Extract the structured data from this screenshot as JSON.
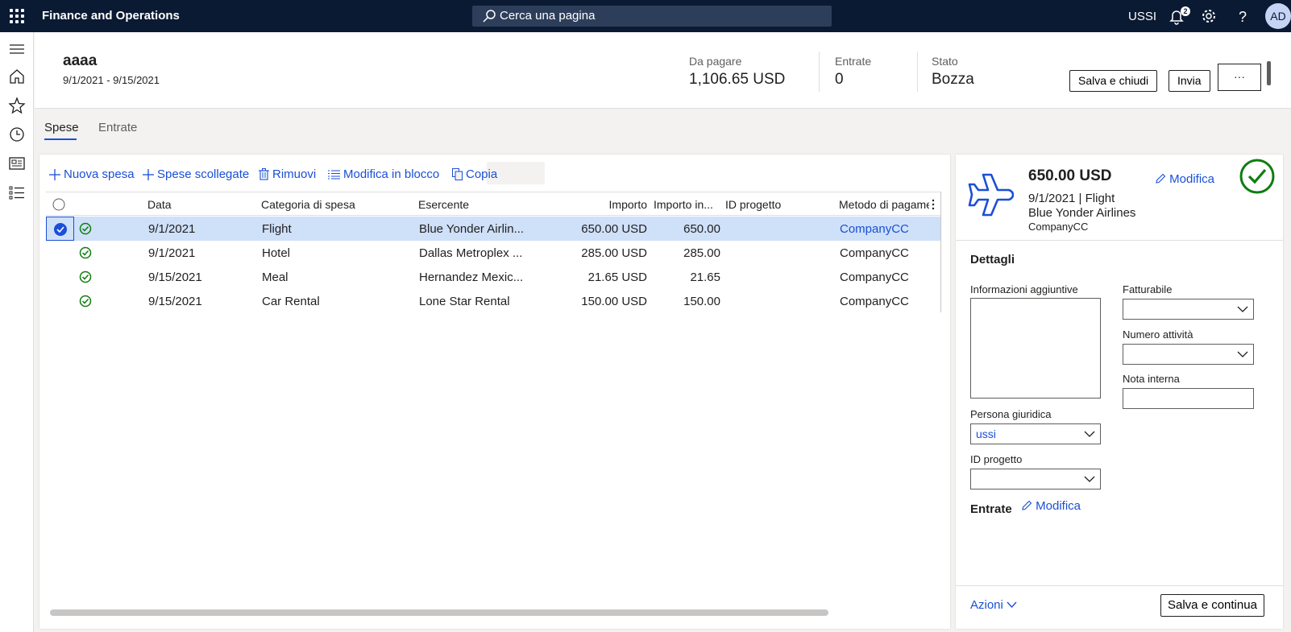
{
  "topbar": {
    "app_title": "Finance and Operations",
    "search_placeholder": "Cerca una pagina",
    "company": "USSI",
    "notification_count": "2",
    "avatar_initials": "AD"
  },
  "header": {
    "title": "aaaa",
    "dates": "9/1/2021 - 9/15/2021",
    "kpis": [
      {
        "label": "Da pagare",
        "value": "1,106.65 USD"
      },
      {
        "label": "Entrate",
        "value": "0"
      },
      {
        "label": "Stato",
        "value": "Bozza"
      }
    ],
    "save_close_label": "Salva e chiudi",
    "send_label": "Invia",
    "more_label": "···"
  },
  "tabs": [
    {
      "label": "Spese",
      "active": true
    },
    {
      "label": "Entrate",
      "active": false
    }
  ],
  "toolbar": {
    "new_expense": "Nuova spesa",
    "unattached": "Spese scollegate",
    "remove": "Rimuovi",
    "bulk_edit": "Modifica in blocco",
    "copy": "Copia"
  },
  "grid": {
    "columns": [
      "Data",
      "Categoria di spesa",
      "Esercente",
      "Importo",
      "Importo in...",
      "ID progetto",
      "Metodo di pagame"
    ],
    "rows": [
      {
        "date": "9/1/2021",
        "category": "Flight",
        "merchant": "Blue Yonder Airlin...",
        "amount": "650.00 USD",
        "amount_in": "650.00",
        "project": "",
        "method": "CompanyCC",
        "selected": true
      },
      {
        "date": "9/1/2021",
        "category": "Hotel",
        "merchant": "Dallas Metroplex ...",
        "amount": "285.00 USD",
        "amount_in": "285.00",
        "project": "",
        "method": "CompanyCC",
        "selected": false
      },
      {
        "date": "9/15/2021",
        "category": "Meal",
        "merchant": "Hernandez Mexic...",
        "amount": "21.65 USD",
        "amount_in": "21.65",
        "project": "",
        "method": "CompanyCC",
        "selected": false
      },
      {
        "date": "9/15/2021",
        "category": "Car Rental",
        "merchant": "Lone Star Rental",
        "amount": "150.00 USD",
        "amount_in": "150.00",
        "project": "",
        "method": "CompanyCC",
        "selected": false
      }
    ]
  },
  "detail": {
    "amount": "650.00 USD",
    "date_category": "9/1/2021 | Flight",
    "merchant": "Blue Yonder Airlines",
    "method": "CompanyCC",
    "edit_label": "Modifica",
    "details_title": "Dettagli",
    "additional_info_label": "Informazioni aggiuntive",
    "billable_label": "Fatturabile",
    "activity_number_label": "Numero attività",
    "internal_note_label": "Nota interna",
    "legal_entity_label": "Persona giuridica",
    "legal_entity_value": "ussi",
    "project_id_label": "ID progetto",
    "receipts_title": "Entrate",
    "receipts_edit_label": "Modifica",
    "actions_label": "Azioni",
    "save_continue_label": "Salva e continua"
  },
  "colors": {
    "topbar": "#0b1a33",
    "accent": "#1a4fd6",
    "success": "#107c10",
    "selected_row": "#cfe0f9"
  }
}
